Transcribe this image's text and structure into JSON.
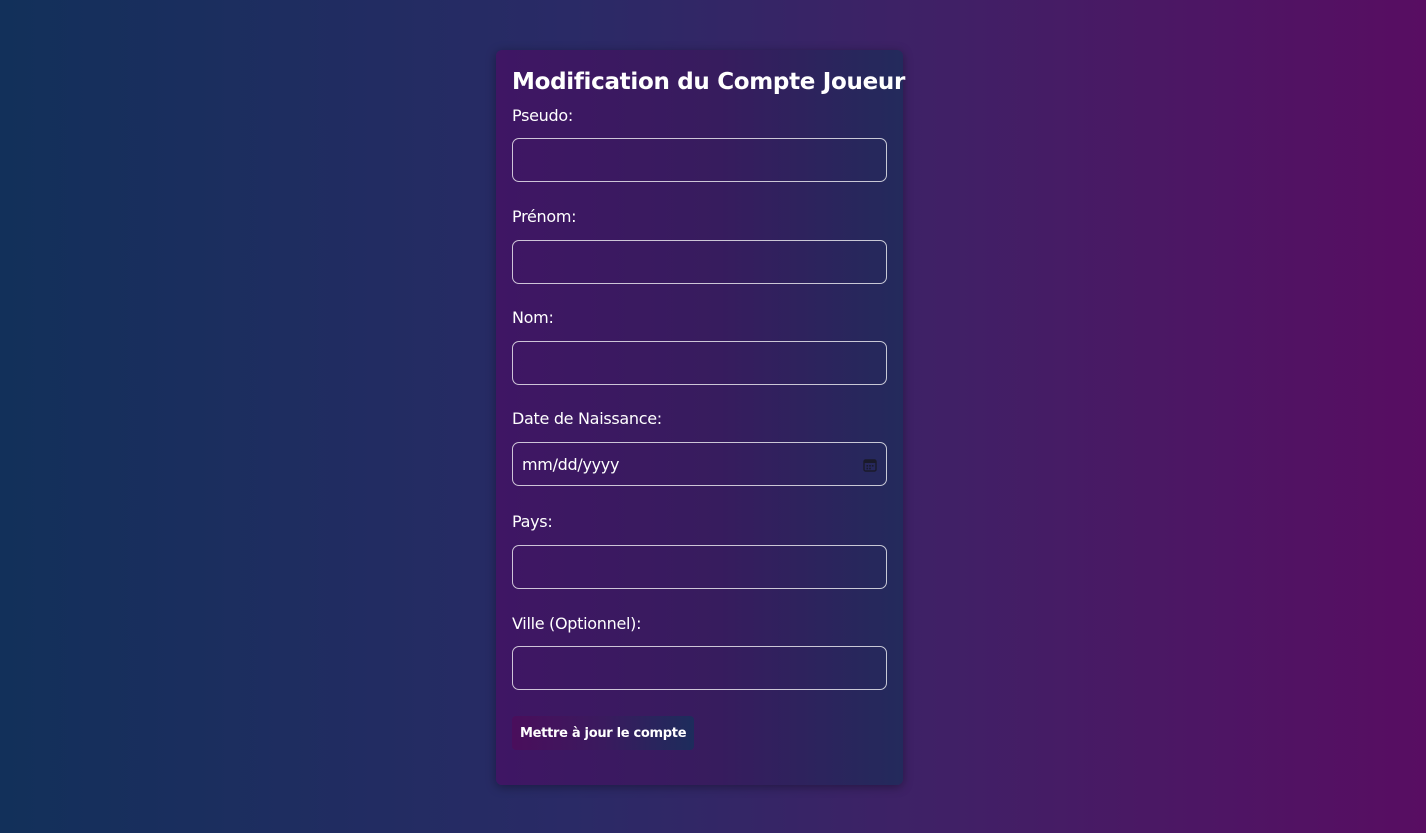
{
  "form": {
    "title": "Modification du Compte Joueur",
    "fields": [
      {
        "label": "Pseudo:",
        "value": ""
      },
      {
        "label": "Prénom:",
        "value": ""
      },
      {
        "label": "Nom:",
        "value": ""
      },
      {
        "label": "Date de Naissance:",
        "value": "mm/dd/yyyy"
      },
      {
        "label": "Pays:",
        "value": ""
      },
      {
        "label": "Ville (Optionnel):",
        "value": ""
      }
    ],
    "submit_label": "Mettre à jour le compte"
  },
  "colors": {
    "background_left": "#12305a",
    "background_right": "#580d62",
    "card": "#371c5e",
    "text": "#ffffff"
  }
}
